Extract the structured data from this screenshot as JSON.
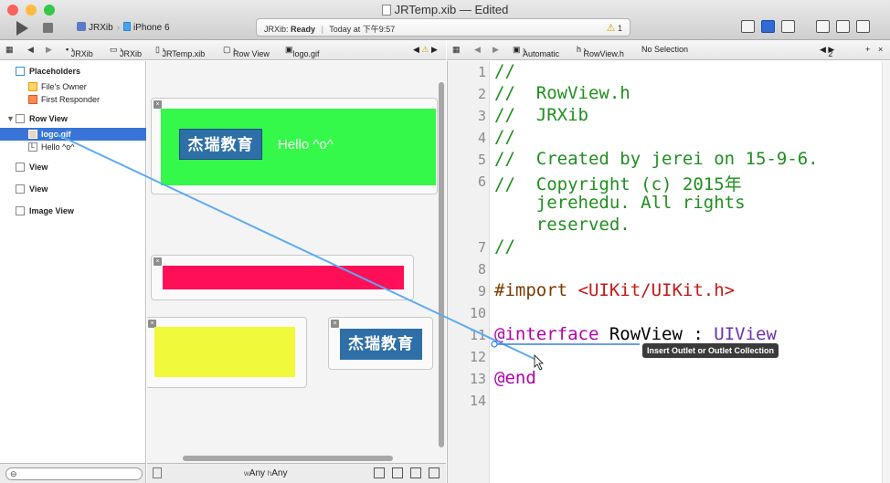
{
  "window": {
    "title": "JRTemp.xib — Edited",
    "scheme": "JRXib",
    "device": "iPhone 6",
    "status_app": "JRXib:",
    "status_state": "Ready",
    "status_time": "Today at 下午9:57",
    "warning_count": "1",
    "traffic_colors": [
      "#fc605c",
      "#fdbc40",
      "#34c84a"
    ]
  },
  "left_jumpbar": {
    "items": [
      "JRXib",
      "JRXib",
      "JRTemp.xib",
      "Row View",
      "logo.gif"
    ]
  },
  "right_jumpbar": {
    "mode": "Automatic",
    "file": "RowView.h",
    "selection": "No Selection",
    "counter": "2"
  },
  "outline": {
    "placeholders_header": "Placeholders",
    "files_owner": "File's Owner",
    "first_responder": "First Responder",
    "row_view": "Row View",
    "logo": "logo.gif",
    "hello": "Hello ^o^",
    "view1": "View",
    "view2": "View",
    "image_view": "Image View"
  },
  "canvas": {
    "logo_text": "杰瑞教育",
    "hello_text": "Hello ^o^",
    "size_w_label": "Any",
    "size_h_label": "Any",
    "colors": {
      "green": "#34f94a",
      "pink": "#ff0f58",
      "yellow": "#f0f93a",
      "logo_blue": "#2e6fa7"
    }
  },
  "editor": {
    "line_numbers": [
      "1",
      "2",
      "3",
      "4",
      "5",
      "6",
      "7",
      "8",
      "9",
      "10",
      "11",
      "12",
      "13",
      "14"
    ],
    "line1": "//",
    "line2": "//  RowView.h",
    "line3": "//  JRXib",
    "line4": "//",
    "line5": "//  Created by jerei on 15-9-6.",
    "line6": "//  Copyright (c) 2015年",
    "line6b": "    jerehedu. All rights",
    "line6c": "    reserved.",
    "line7": "//",
    "line9_kw": "#import",
    "line9_str": "<UIKit/UIKit.h>",
    "line11_kw": "@interface",
    "line11_name": "RowView",
    "line11_colon": ":",
    "line11_super": "UIView",
    "line13": "@end",
    "tooltip": "Insert Outlet or Outlet Collection"
  }
}
